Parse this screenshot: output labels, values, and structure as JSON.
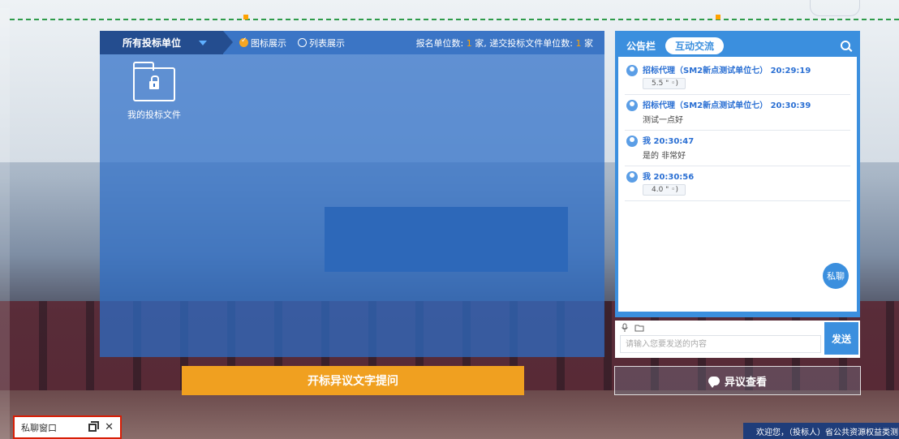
{
  "main": {
    "unit_selector": "所有投标单位",
    "view_options": [
      "图标展示",
      "列表展示"
    ],
    "stats": {
      "signup_label": "报名单位数:",
      "signup_count": "1",
      "signup_unit": "家,",
      "submit_label": "递交投标文件单位数:",
      "submit_count": "1",
      "submit_unit": "家"
    },
    "file_label": "我的投标文件"
  },
  "chat": {
    "tabs": [
      "公告栏",
      "互动交流"
    ],
    "active_tab": "互动交流",
    "messages": [
      {
        "sender": "招标代理（SM2新点测试单位七） 20:29:19",
        "voice": "5.5 \" ◦)"
      },
      {
        "sender": "招标代理（SM2新点测试单位七） 20:30:39",
        "text": "测试一点好"
      },
      {
        "sender": "我 20:30:47",
        "text": "是的 非常好"
      },
      {
        "sender": "我 20:30:56",
        "voice": "4.0 \" ◦)"
      }
    ],
    "private_btn": "私聊"
  },
  "input": {
    "placeholder": "请输入您要发送的内容",
    "send_label": "发送"
  },
  "buttons": {
    "question": "开标异议文字提问",
    "objection": "异议查看"
  },
  "private_window": {
    "title": "私聊窗口"
  },
  "welcome": "欢迎您，（投标人）省公共资源权益类测",
  "colors": {
    "accent": "#3b8fde",
    "orange": "#f0a020",
    "highlight": "#d81e06"
  }
}
